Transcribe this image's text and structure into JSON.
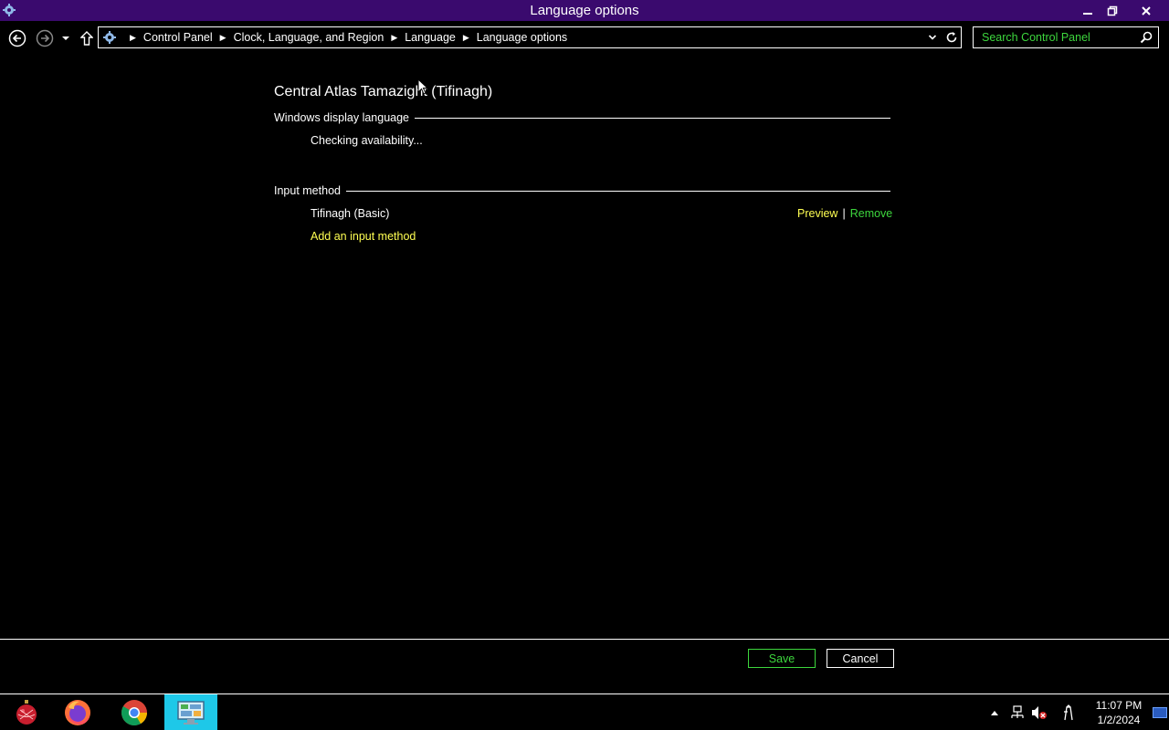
{
  "window": {
    "title": "Language options"
  },
  "nav": {
    "breadcrumbs": [
      "Control Panel",
      "Clock, Language, and Region",
      "Language",
      "Language options"
    ],
    "search_placeholder": "Search Control Panel"
  },
  "content": {
    "language_name": "Central Atlas Tamazight (Tifinagh)",
    "display_language_header": "Windows display language",
    "display_language_status": "Checking availability...",
    "input_method_header": "Input method",
    "input_methods": [
      {
        "name": "Tifinagh (Basic)",
        "preview_label": "Preview",
        "remove_label": "Remove"
      }
    ],
    "add_input_method_label": "Add an input method"
  },
  "buttons": {
    "save_label": "Save",
    "cancel_label": "Cancel"
  },
  "taskbar": {
    "apps": [
      {
        "name": "start-button",
        "icon": "ornament-icon"
      },
      {
        "name": "firefox",
        "icon": "firefox-icon"
      },
      {
        "name": "chrome",
        "icon": "chrome-icon"
      },
      {
        "name": "control-panel",
        "icon": "control-panel-icon",
        "active": true
      }
    ],
    "time": "11:07 PM",
    "date": "1/2/2024"
  },
  "colors": {
    "titlebar": "#3a0a6e",
    "link_yellow": "#ffff52",
    "link_green": "#3dd63d",
    "taskbar_active": "#1ec8e8"
  }
}
